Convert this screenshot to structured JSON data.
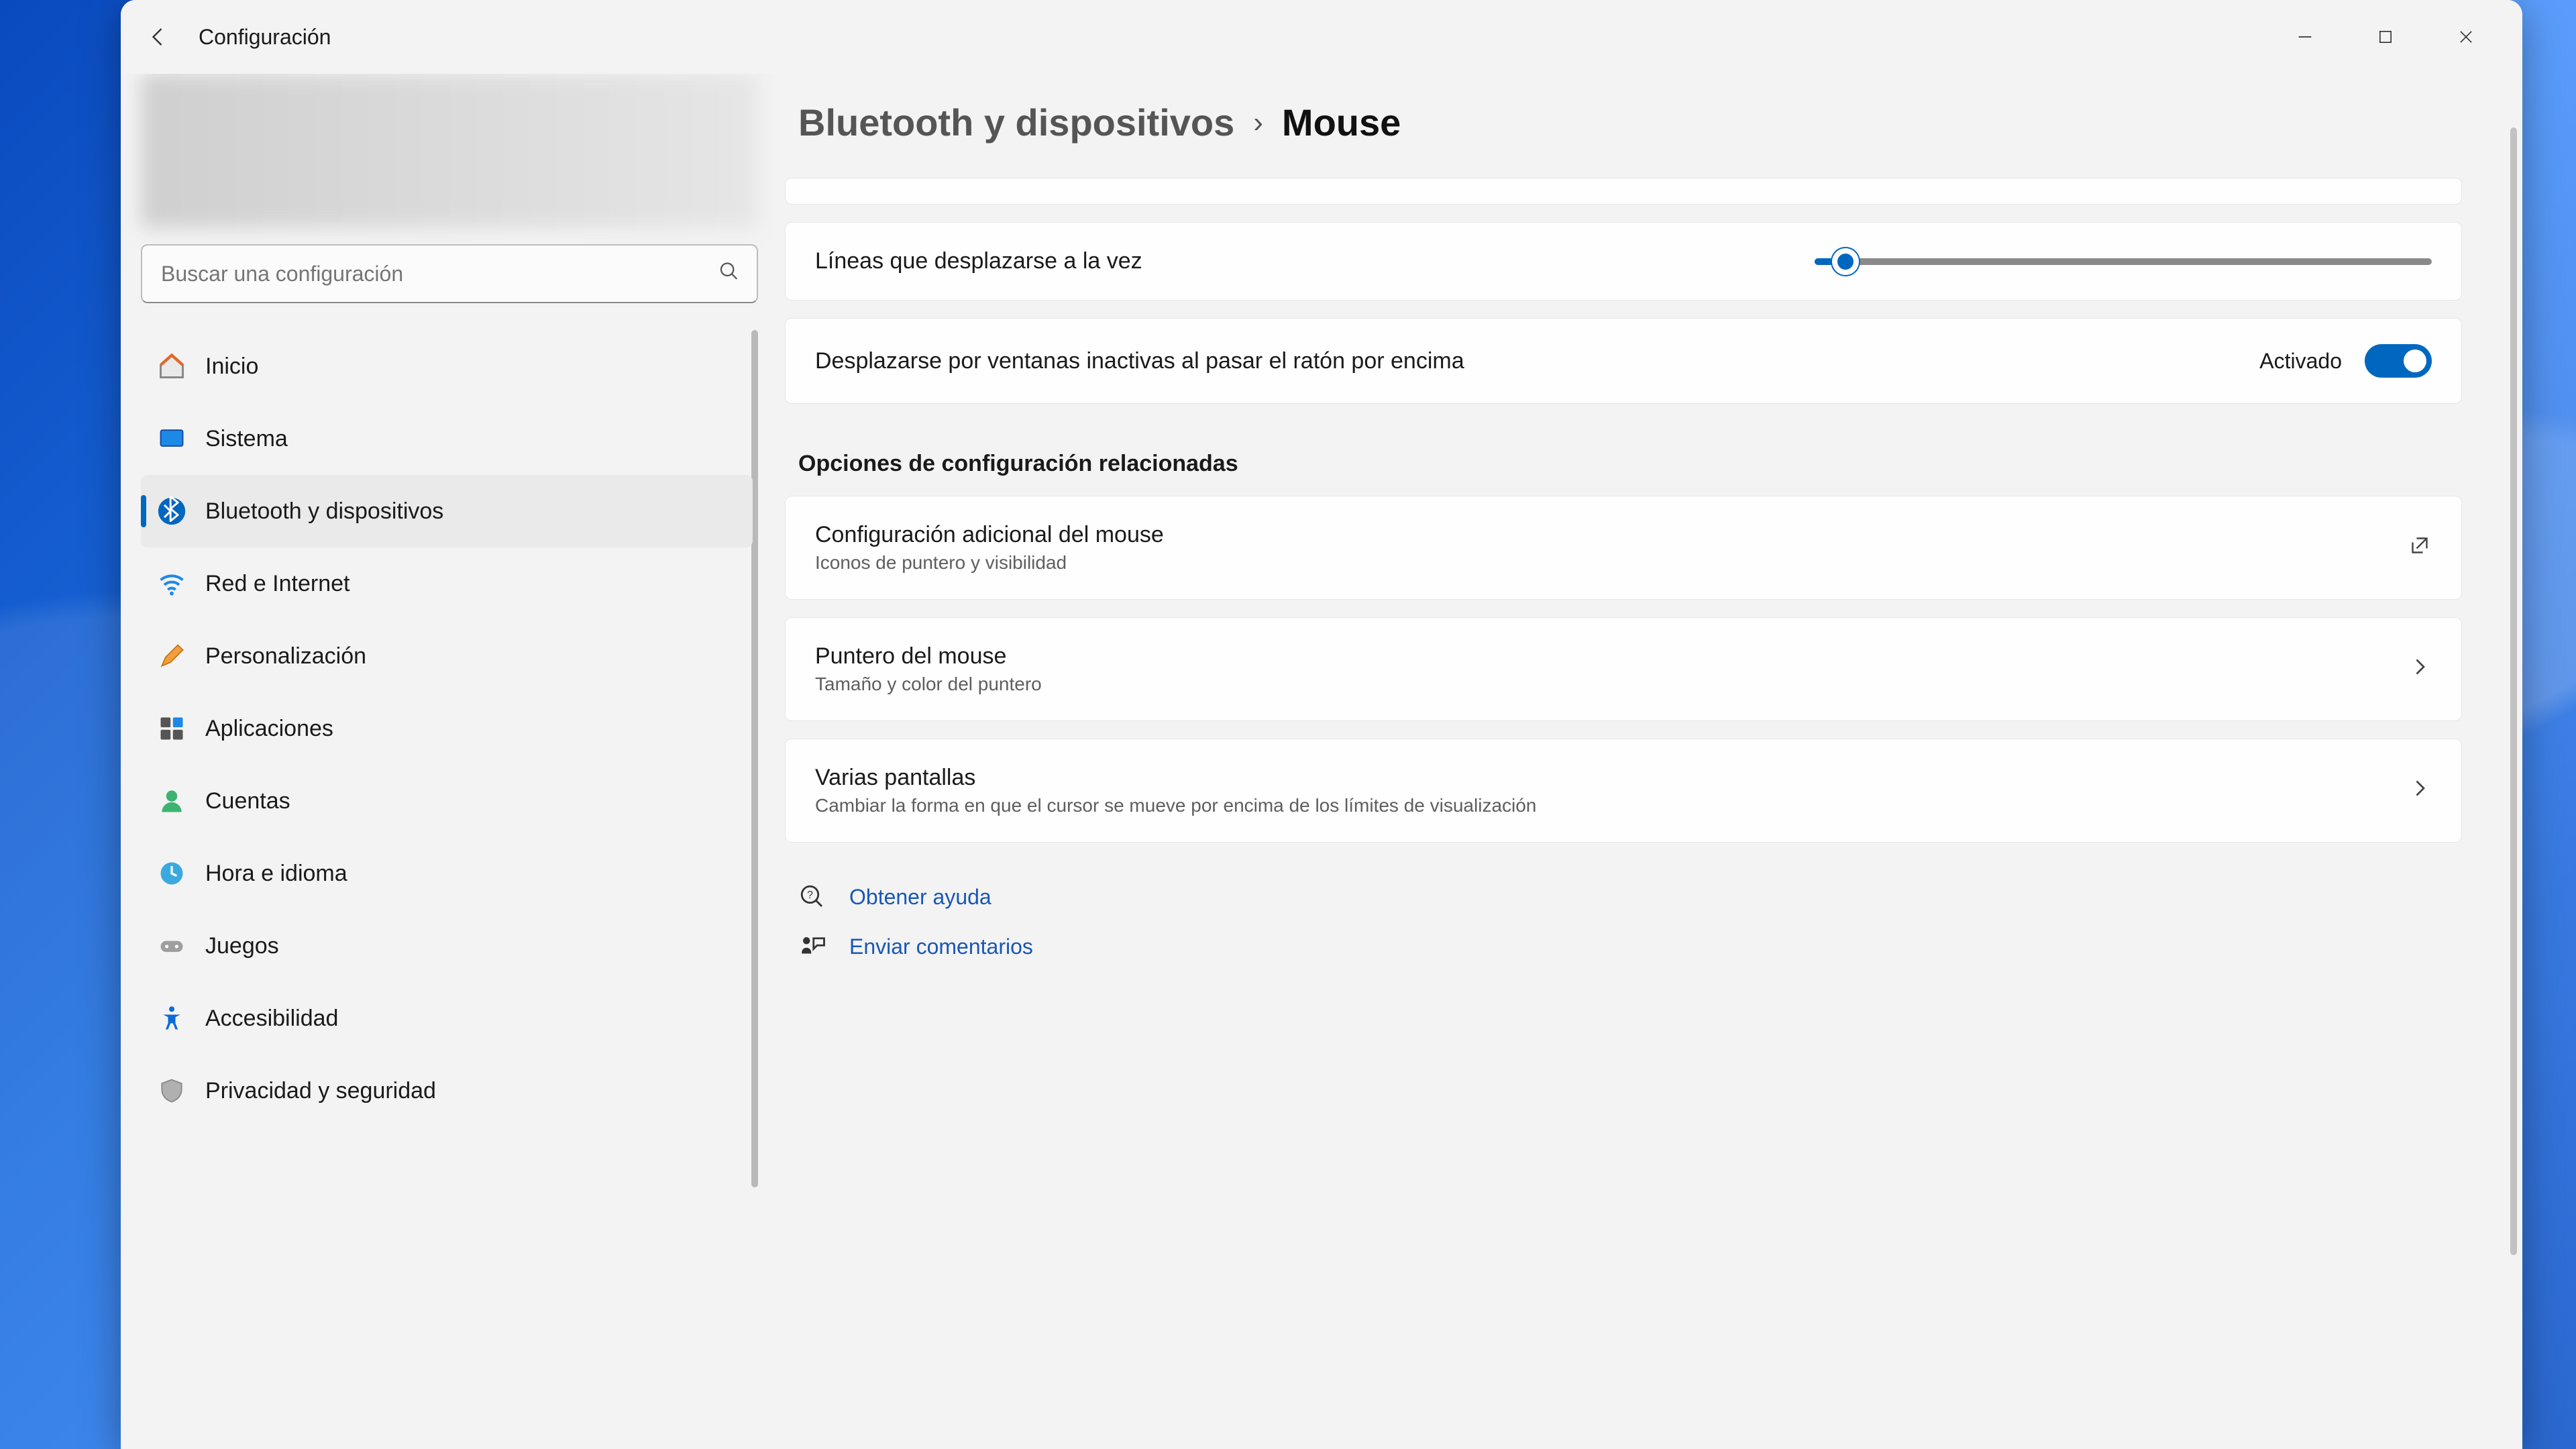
{
  "titlebar": {
    "app_title": "Configuración"
  },
  "search": {
    "placeholder": "Buscar una configuración"
  },
  "sidebar": {
    "items": [
      {
        "label": "Inicio"
      },
      {
        "label": "Sistema"
      },
      {
        "label": "Bluetooth y dispositivos"
      },
      {
        "label": "Red e Internet"
      },
      {
        "label": "Personalización"
      },
      {
        "label": "Aplicaciones"
      },
      {
        "label": "Cuentas"
      },
      {
        "label": "Hora e idioma"
      },
      {
        "label": "Juegos"
      },
      {
        "label": "Accesibilidad"
      },
      {
        "label": "Privacidad y seguridad"
      }
    ]
  },
  "breadcrumb": {
    "parent": "Bluetooth y dispositivos",
    "current": "Mouse"
  },
  "settings": {
    "scroll_lines_label": "Líneas que desplazarse a la vez",
    "scroll_lines_value": 5,
    "scroll_inactive_label": "Desplazarse por ventanas inactivas al pasar el ratón por encima",
    "scroll_inactive_state": "Activado"
  },
  "related": {
    "heading": "Opciones de configuración relacionadas",
    "items": [
      {
        "title": "Configuración adicional del mouse",
        "sub": "Iconos de puntero y visibilidad",
        "action": "external"
      },
      {
        "title": "Puntero del mouse",
        "sub": "Tamaño y color del puntero",
        "action": "chevron"
      },
      {
        "title": "Varias pantallas",
        "sub": "Cambiar la forma en que el cursor se mueve por encima de los límites de visualización",
        "action": "chevron"
      }
    ]
  },
  "footer": {
    "help": "Obtener ayuda",
    "feedback": "Enviar comentarios"
  },
  "colors": {
    "accent": "#0067c0"
  }
}
